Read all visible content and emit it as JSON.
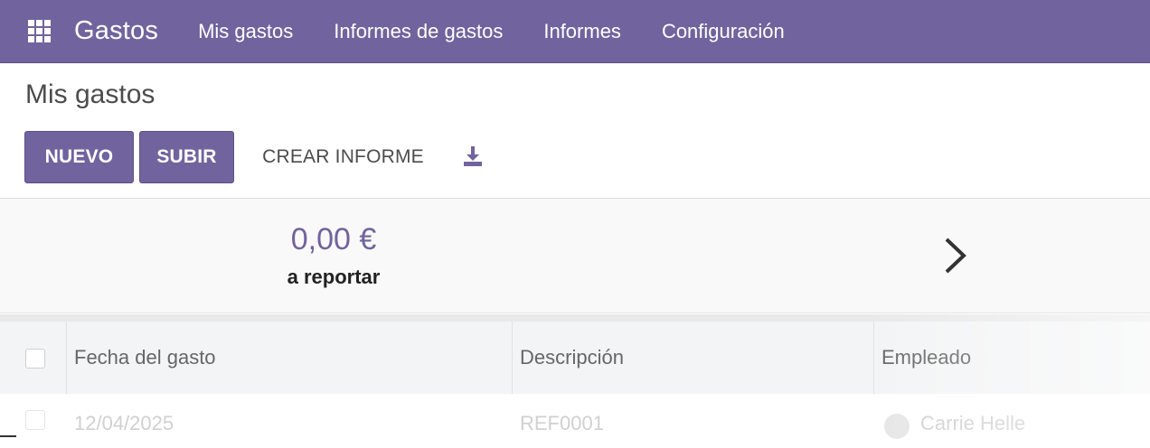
{
  "navbar": {
    "brand": "Gastos",
    "items": [
      {
        "label": "Mis gastos"
      },
      {
        "label": "Informes de gastos"
      },
      {
        "label": "Informes"
      },
      {
        "label": "Configuración"
      }
    ],
    "color": "#71639e"
  },
  "control_panel": {
    "breadcrumb": "Mis gastos",
    "buttons": {
      "new": "NUEVO",
      "upload": "SUBIR",
      "create_report": "CREAR INFORME"
    },
    "download_icon": "download-icon"
  },
  "dashboard": {
    "amount": "0,00 €",
    "amount_label": "a reportar"
  },
  "list": {
    "columns": [
      "Fecha del gasto",
      "Descripción",
      "Empleado"
    ],
    "rows": [
      {
        "date": "12/04/2025",
        "description": "REF0001",
        "employee": "Carrie Helle"
      }
    ]
  },
  "colors": {
    "accent": "#71639e",
    "text": "#4c4c4c"
  }
}
